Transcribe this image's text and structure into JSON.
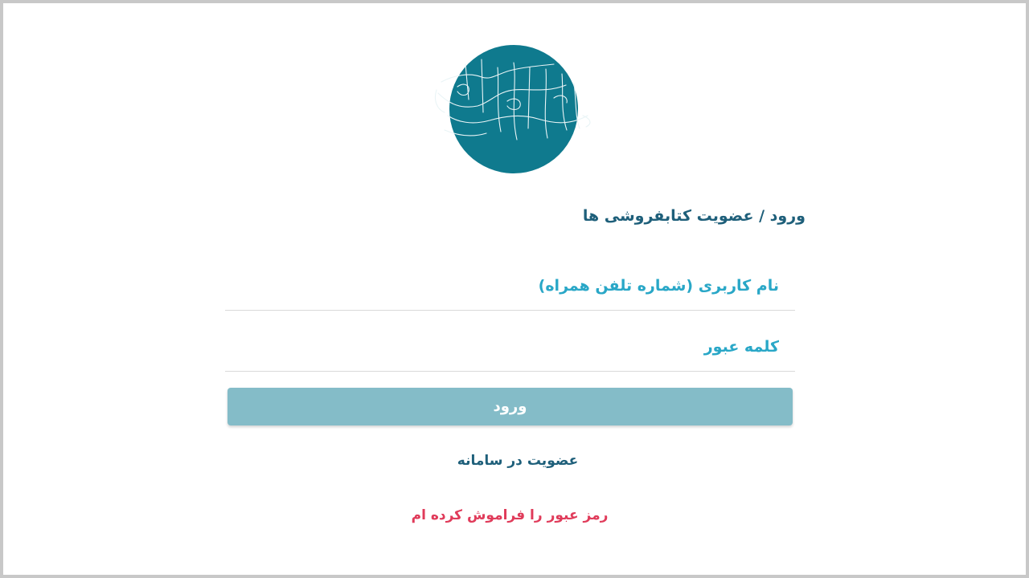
{
  "login": {
    "title": "ورود / عضویت کتابفروشی ها",
    "username": {
      "placeholder": "نام کاربری (شماره تلفن همراه)",
      "value": ""
    },
    "password": {
      "placeholder": "کلمه عبور",
      "value": ""
    },
    "submit_label": "ورود",
    "register_label": "عضویت در سامانه",
    "forgot_label": "رمز عبور را فراموش کرده ام"
  },
  "colors": {
    "logo_circle": "#0f7a8e",
    "title": "#1e5f7a",
    "placeholder": "#29a7c7",
    "button": "#84bcc8",
    "forgot": "#e03b5a"
  },
  "icons": {
    "logo": "calligraphy-logo"
  }
}
